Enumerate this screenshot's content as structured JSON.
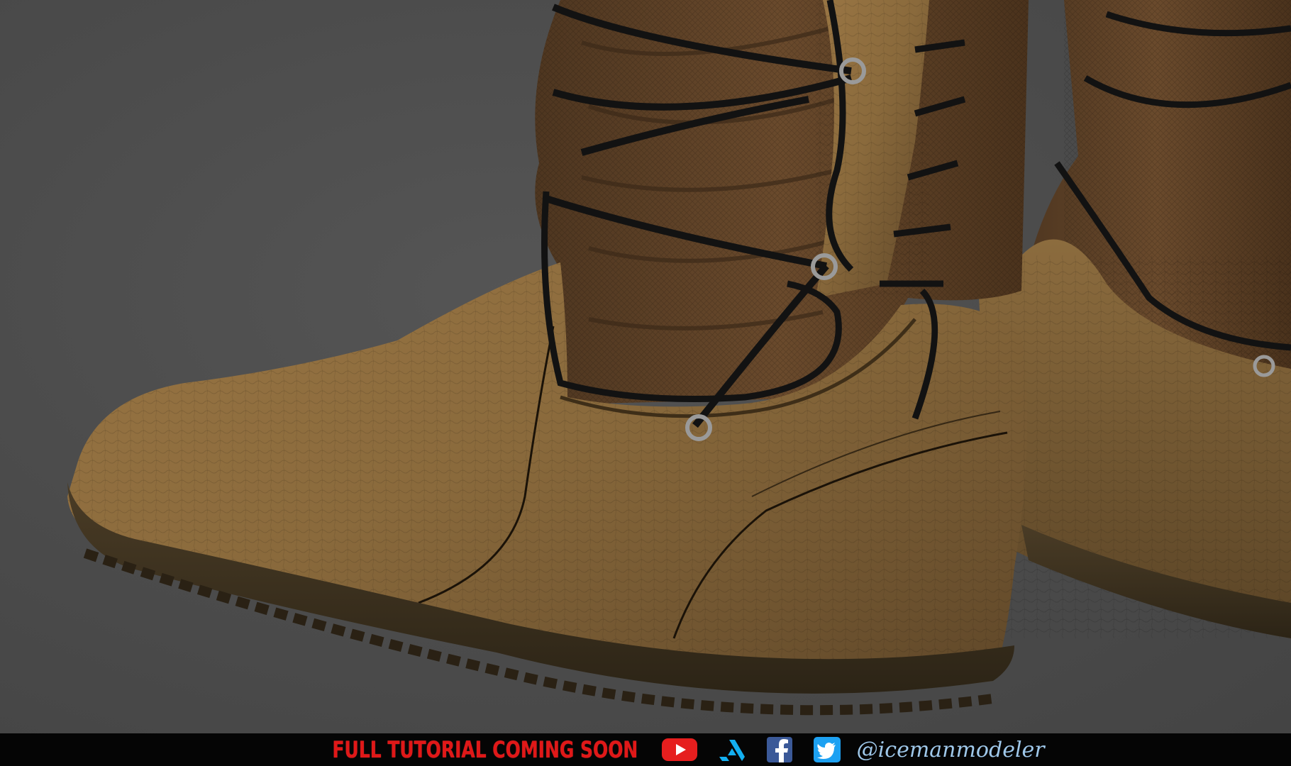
{
  "scene": {
    "subject": "",
    "background_color": "#4a4a4a",
    "leather_color": "#8a6a3c",
    "cloth_color": "#5e4226",
    "lace_color": "#121212",
    "sole_color": "#3a2f1e"
  },
  "footer": {
    "tutorial_text": "FULL TUTORIAL COMING SOON",
    "handle": "@icemanmodeler",
    "text_color": "#e01818",
    "handle_color": "#9fc8ea",
    "icons": [
      "youtube-icon",
      "artstation-icon",
      "facebook-icon",
      "twitter-icon"
    ]
  }
}
